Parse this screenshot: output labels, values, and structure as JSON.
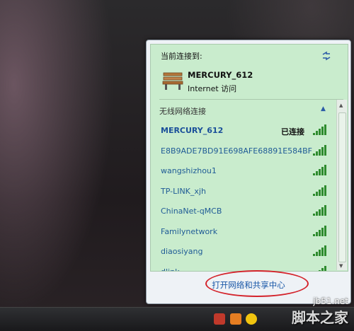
{
  "current": {
    "title": "当前连接到:",
    "network_name": "MERCURY_612",
    "access": "Internet 访问"
  },
  "wireless": {
    "section_label": "无线网络连接",
    "collapse_glyph": "▲",
    "networks": [
      {
        "name": "MERCURY_612",
        "status": "已连接",
        "connected": true
      },
      {
        "name": "E8B9ADE7BD91E698AFE68891E584BF",
        "status": "",
        "connected": false
      },
      {
        "name": "wangshizhou1",
        "status": "",
        "connected": false
      },
      {
        "name": "TP-LINK_xjh",
        "status": "",
        "connected": false
      },
      {
        "name": "ChinaNet-qMCB",
        "status": "",
        "connected": false
      },
      {
        "name": "Familynetwork",
        "status": "",
        "connected": false
      },
      {
        "name": "diaosiyang",
        "status": "",
        "connected": false
      },
      {
        "name": "dlink",
        "status": "",
        "connected": false
      }
    ]
  },
  "footer": {
    "open_center": "打开网络和共享中心"
  },
  "icons": {
    "refresh": "refresh-icon",
    "connection": "bench-icon",
    "signal": "signal-strength-icon"
  },
  "colors": {
    "panel_green": "#c9eccd",
    "link_blue": "#1a58a8",
    "highlight_red": "#d4232b"
  },
  "watermark": {
    "site": "jb51.net",
    "name": "脚本之家"
  }
}
